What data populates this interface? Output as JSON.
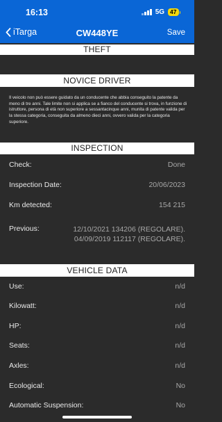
{
  "status_bar": {
    "time": "16:13",
    "network": "5G",
    "battery": "47"
  },
  "nav": {
    "back_label": "iTarga",
    "title": "CW448YE",
    "save_label": "Save"
  },
  "sections": {
    "theft": "THEFT",
    "novice": "NOVICE DRIVER",
    "inspection": "INSPECTION",
    "vehicle": "VEHICLE DATA"
  },
  "novice_text": "Il veicolo non può essere guidato da un conducente che abbia conseguito la patente da meno di tre anni. Tale limite non si applica se a fianco del conducente si trova, in funzione di istruttore, persona di età non superiore a sessantacinque anni, munita di patente valida per la stessa categoria, conseguita da almeno dieci anni, ovvero valida per la categoria superiore.",
  "inspection": {
    "check_label": "Check:",
    "check_value": "Done",
    "date_label": "Inspection Date:",
    "date_value": "20/06/2023",
    "km_label": "Km detected:",
    "km_value": "154 215",
    "previous_label": "Previous:",
    "previous_values": [
      "12/10/2021 134206 (REGOLARE).",
      "04/09/2019 112117 (REGOLARE)."
    ]
  },
  "vehicle": [
    {
      "label": "Use:",
      "value": "n/d"
    },
    {
      "label": "Kilowatt:",
      "value": "n/d"
    },
    {
      "label": "HP:",
      "value": "n/d"
    },
    {
      "label": "Seats:",
      "value": "n/d"
    },
    {
      "label": "Axles:",
      "value": "n/d"
    },
    {
      "label": "Ecological:",
      "value": "No"
    },
    {
      "label": "Automatic Suspension:",
      "value": "No"
    }
  ]
}
